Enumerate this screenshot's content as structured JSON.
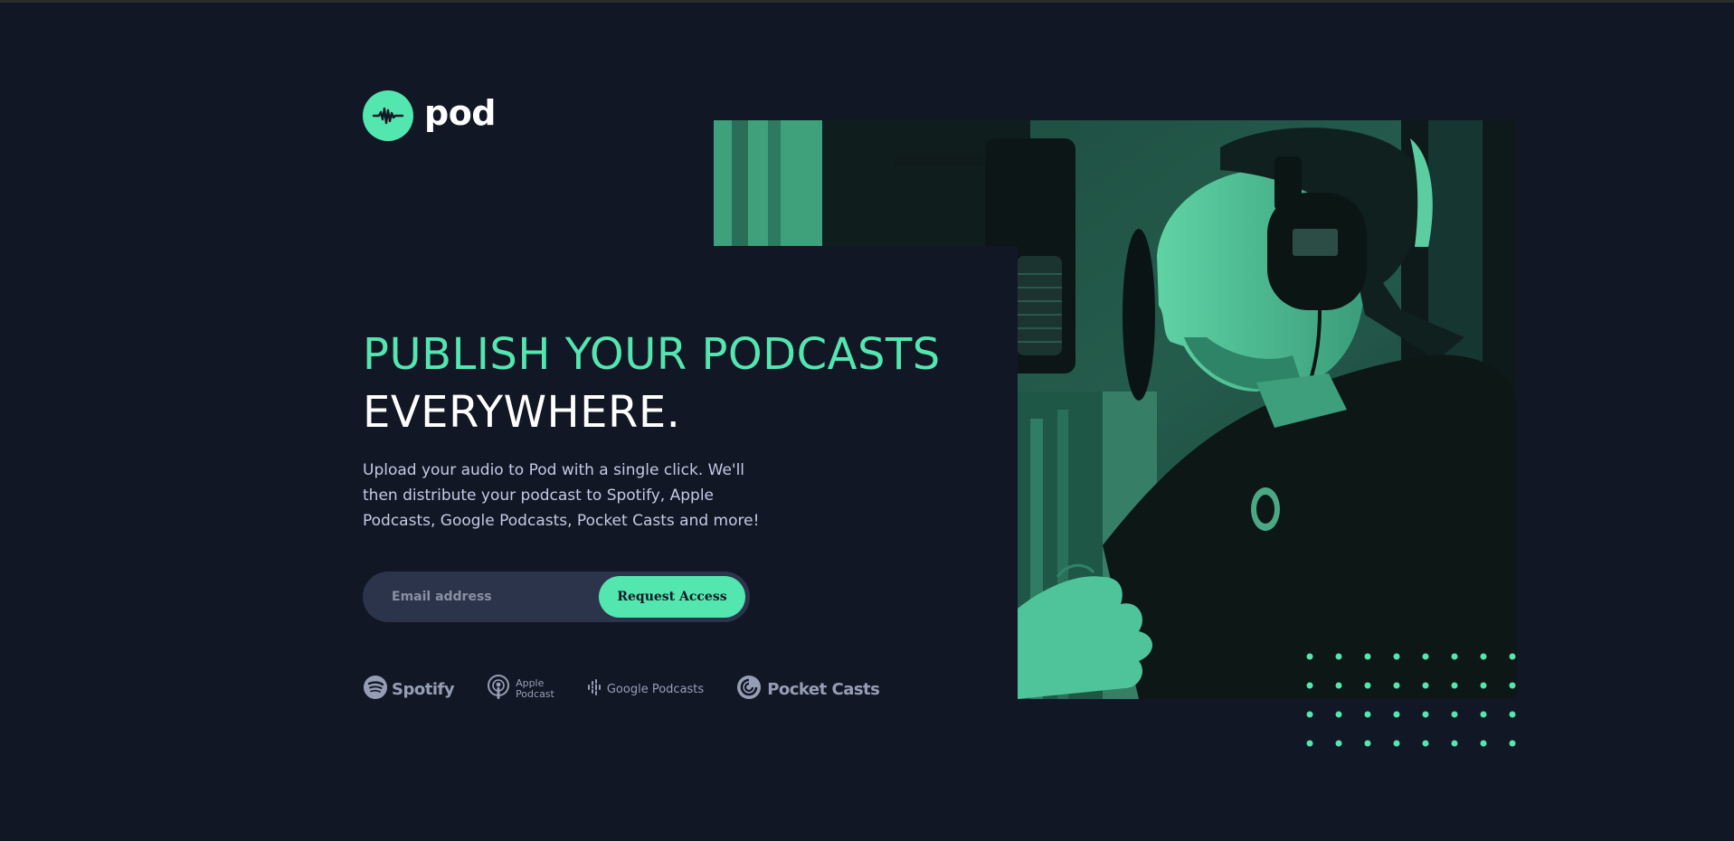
{
  "brand": {
    "name": "pod",
    "accent": "#54e6af",
    "background": "#121725",
    "logo_icon": "sound-wave-icon"
  },
  "hero": {
    "headline_line1": "PUBLISH YOUR PODCASTS",
    "headline_line2": "EVERYWHERE.",
    "description": "Upload your audio to Pod with a single click. We'll then distribute your podcast to Spotify, Apple Podcasts, Google Podcasts, Pocket Casts and more!",
    "photo": "podcaster-at-microphone-image"
  },
  "form": {
    "email_placeholder": "Email address",
    "email_value": "",
    "submit_label": "Request Access"
  },
  "platforms": [
    {
      "name": "Spotify",
      "icon": "spotify-icon"
    },
    {
      "name": "Apple Podcast",
      "icon": "apple-podcast-icon",
      "line1": "Apple",
      "line2": "Podcast"
    },
    {
      "name": "Google Podcasts",
      "icon": "google-podcasts-icon"
    },
    {
      "name": "Pocket Casts",
      "icon": "pocket-casts-icon"
    }
  ],
  "decoration": {
    "dot_grid": "dot-grid-pattern",
    "dot_color": "#54e6af"
  }
}
